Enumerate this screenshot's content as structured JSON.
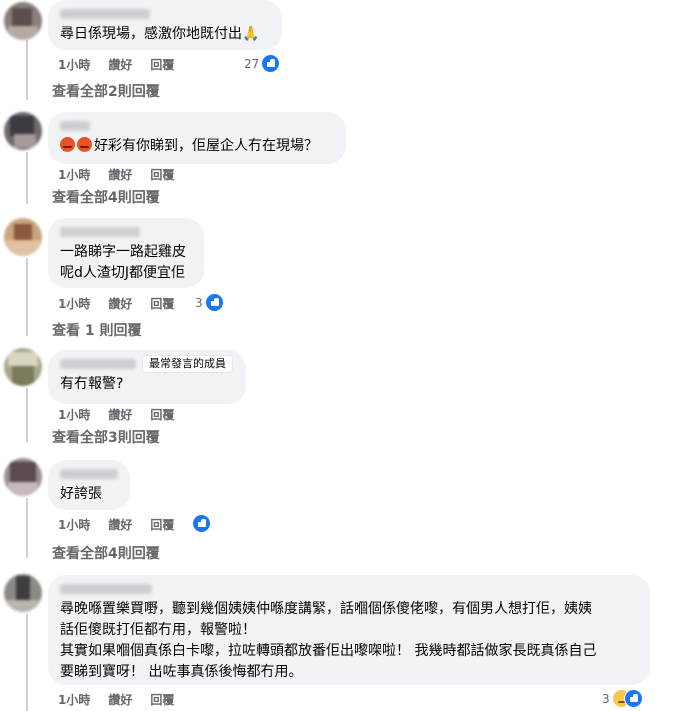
{
  "comments": [
    {
      "author": "",
      "badge": "",
      "text_lines": [
        "尋日係現場，感激你地既付出🙏"
      ],
      "time": "1小時",
      "like": "讚好",
      "reply": "回覆",
      "reaction_count": "27",
      "reaction_icon": "like-icon",
      "view_replies": "查看全部2則回覆"
    },
    {
      "author": "",
      "badge": "",
      "text_lines": [
        "好彩有你睇到，佢屋企人冇在現場？"
      ],
      "time": "1小時",
      "like": "讚好",
      "reply": "回覆",
      "reaction_count": "",
      "reaction_icon": "",
      "view_replies": "查看全部4則回覆"
    },
    {
      "author": "",
      "badge": "",
      "text_lines": [
        "一路睇字一路起雞皮",
        "呢d人渣切J都便宜佢"
      ],
      "time": "1小時",
      "like": "讚好",
      "reply": "回覆",
      "reaction_count": "3",
      "reaction_icon": "like-icon",
      "view_replies": "查看 1 則回覆"
    },
    {
      "author": "",
      "badge": "最常發言的成員",
      "text_lines": [
        "有冇報警?"
      ],
      "time": "1小時",
      "like": "讚好",
      "reply": "回覆",
      "reaction_count": "",
      "reaction_icon": "",
      "view_replies": "查看全部3則回覆"
    },
    {
      "author": "",
      "badge": "",
      "text_lines": [
        "好誇張"
      ],
      "time": "1小時",
      "like": "讚好",
      "reply": "回覆",
      "reaction_count": "",
      "reaction_icon": "like-icon",
      "view_replies": "查看全部4則回覆"
    },
    {
      "author": "",
      "badge": "",
      "text_lines": [
        "尋晚喺置樂買嘢，聽到幾個姨姨仲喺度講緊，話嗰個係傻佬嚟，有個男人想打佢，姨姨",
        "話佢傻既打佢都冇用，報警啦！",
        "其實如果嗰個真係白卡嚟，拉咗轉頭都放番佢出嚟㗎啦！ 我幾時都話做家長既真係自己",
        "要睇到寶呀！ 出咗事真係後悔都冇用。"
      ],
      "time": "1小時",
      "like": "讚好",
      "reply": "回覆",
      "reaction_count": "3",
      "reaction_icon": "sad-icon",
      "view_replies": ""
    }
  ],
  "colors": {
    "bubble": "#f0f2f5",
    "action_text": "#65676b",
    "like_blue": "#1877f2"
  }
}
